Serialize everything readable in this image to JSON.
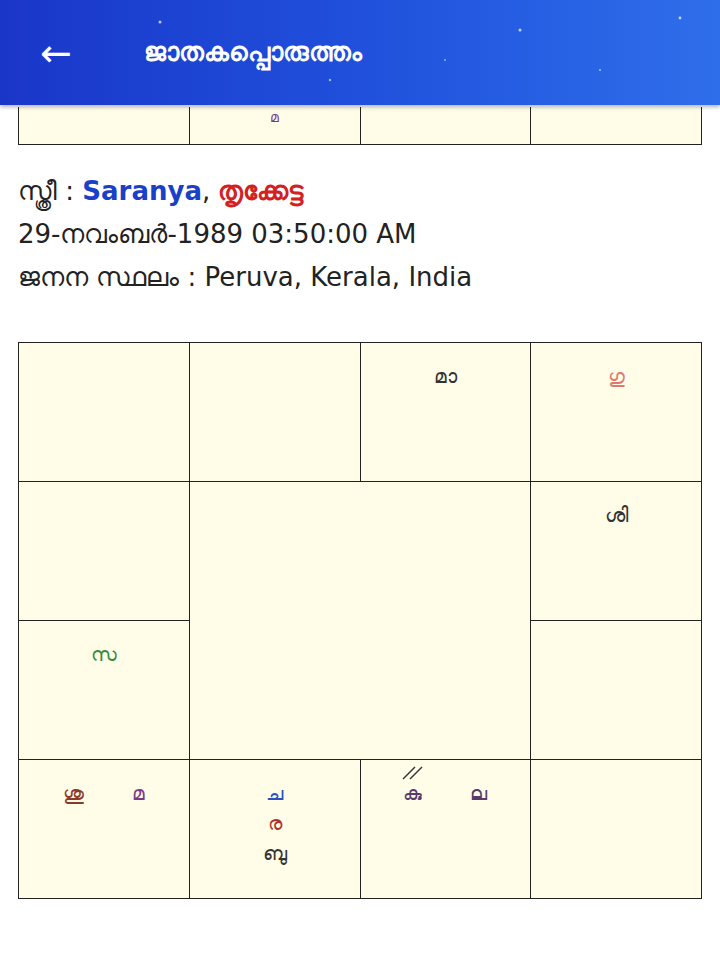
{
  "header": {
    "back": "←",
    "title": "ജാതകപ്പൊരുത്തം"
  },
  "partial_chart": {
    "cells": [
      [],
      [
        {
          "text": "മ",
          "color": "#7a3a8a"
        }
      ],
      [],
      []
    ]
  },
  "person": {
    "label": "സ്ത്രീ :",
    "name": "Saranya",
    "separator": ",",
    "star": "തൃക്കേട്ട",
    "birth": "29-നവംബർ-1989 03:50:00 AM",
    "place_label": "ജനന സ്ഥലം :",
    "place": "Peruva, Kerala, India"
  },
  "chart": {
    "cells": [
      [],
      [],
      [
        {
          "text": "മാ",
          "color": "#333333",
          "marked": false
        }
      ],
      [
        {
          "text": "ഗു",
          "color": "#e07a6e",
          "marked": false
        }
      ],
      [],
      [
        {
          "text": "ശി",
          "color": "#333333",
          "marked": false
        }
      ],
      [
        {
          "text": "സ",
          "color": "#3a8a3a",
          "marked": false
        }
      ],
      [],
      [
        {
          "text": "ശു",
          "color": "#8b3a2a",
          "marked": false
        },
        {
          "text": "മ",
          "color": "#7a3a8a",
          "marked": false
        }
      ],
      [
        {
          "text": "ച",
          "color": "#2a50c0",
          "marked": false
        },
        {
          "text": "ര",
          "color": "#b03030",
          "marked": false
        },
        {
          "text": "ബു",
          "color": "#333333",
          "marked": false
        }
      ],
      [
        {
          "text": "കു",
          "color": "#5a3a6a",
          "marked": true
        },
        {
          "text": "ല",
          "color": "#5a3a6a",
          "marked": false
        }
      ],
      []
    ]
  }
}
